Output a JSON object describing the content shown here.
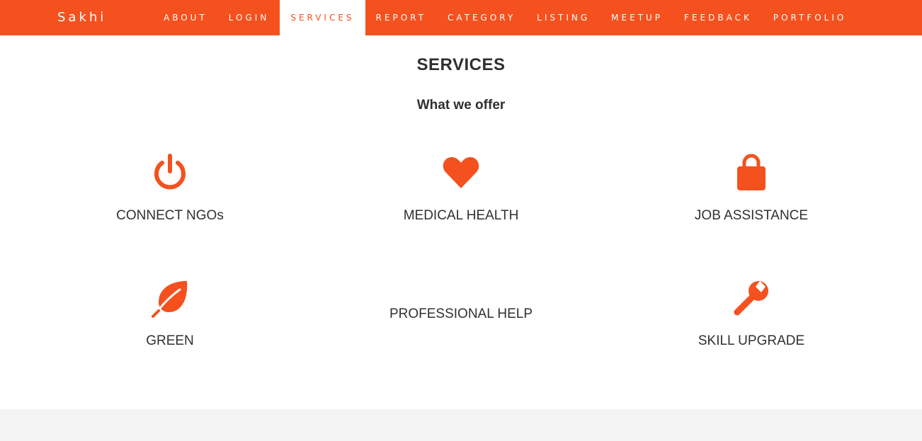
{
  "brand": "Sakhi",
  "nav": {
    "items": [
      {
        "label": "ABOUT"
      },
      {
        "label": "LOGIN"
      },
      {
        "label": "SERVICES",
        "active": true
      },
      {
        "label": "REPORT"
      },
      {
        "label": "CATEGORY"
      },
      {
        "label": "LISTING"
      },
      {
        "label": "MEETUP"
      },
      {
        "label": "FEEDBACK"
      },
      {
        "label": "PORTFOLIO"
      }
    ]
  },
  "services": {
    "title": "SERVICES",
    "subtitle": "What we offer",
    "items": [
      {
        "label": "CONNECT NGOs",
        "icon": "power-icon"
      },
      {
        "label": "MEDICAL HEALTH",
        "icon": "heart-icon"
      },
      {
        "label": "JOB ASSISTANCE",
        "icon": "lock-icon"
      },
      {
        "label": "GREEN",
        "icon": "leaf-icon"
      },
      {
        "label": "PROFESSIONAL HELP",
        "icon": ""
      },
      {
        "label": "SKILL UPGRADE",
        "icon": "wrench-icon"
      }
    ]
  },
  "colors": {
    "accent": "#f4511e",
    "text": "#303030",
    "footer_band": "#f4f4f4"
  }
}
